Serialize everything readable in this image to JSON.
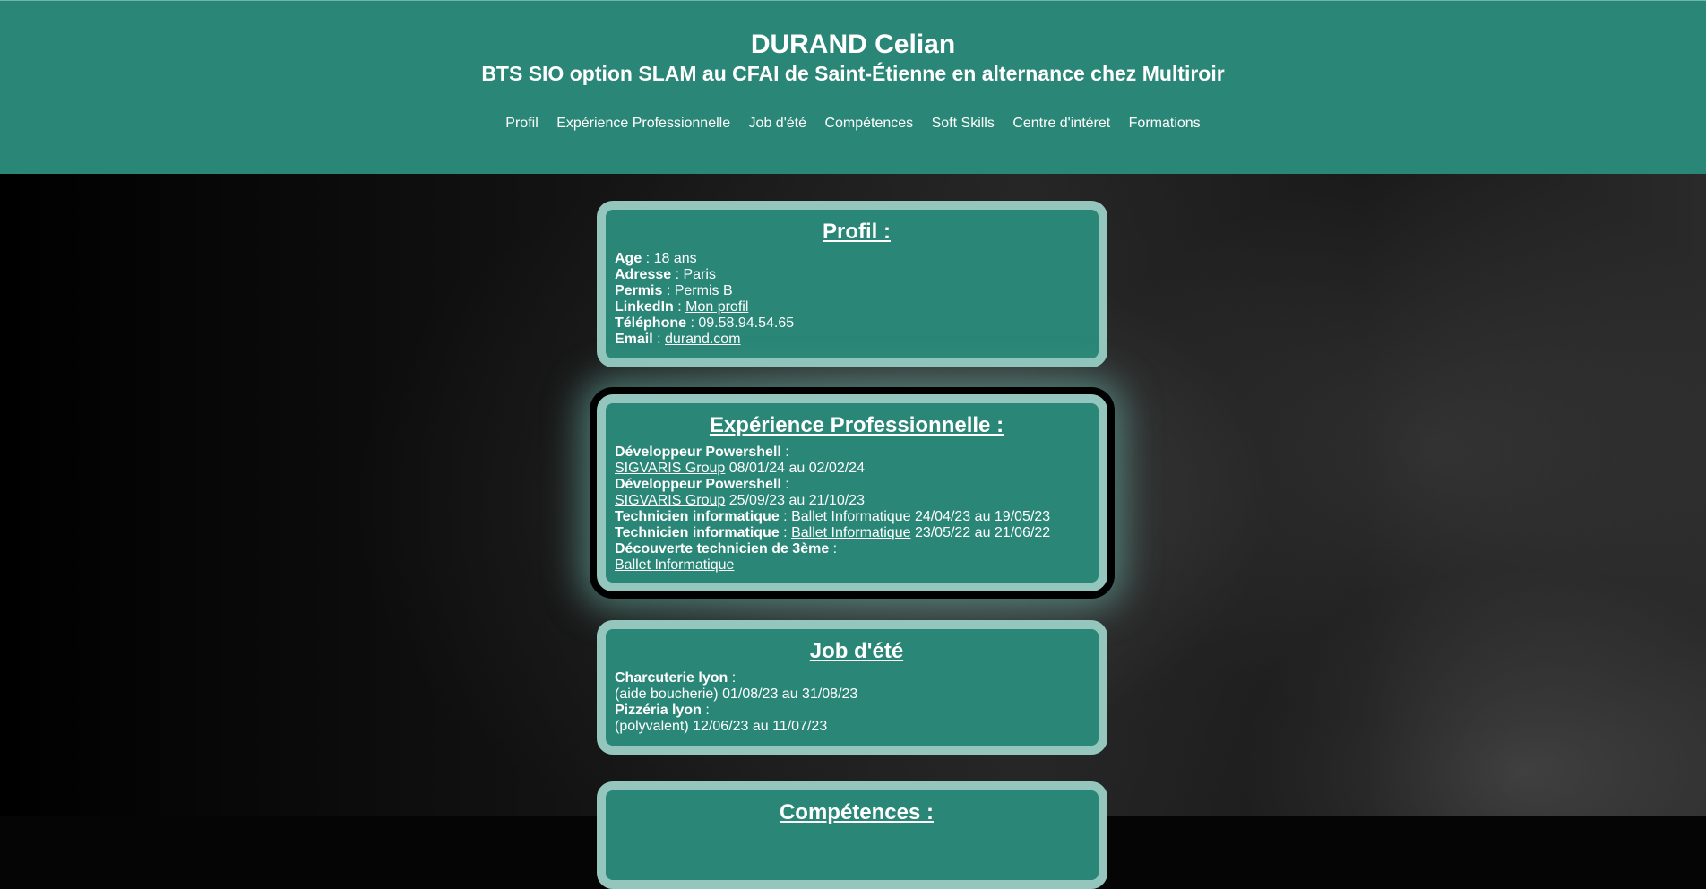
{
  "header": {
    "name": "DURAND Celian",
    "subtitle": "BTS SIO option SLAM au CFAI de Saint-Étienne en alternance chez Multiroir",
    "nav": [
      "Profil",
      "Expérience Professionnelle",
      "Job d'été",
      "Compétences",
      "Soft Skills",
      "Centre d'intéret",
      "Formations"
    ]
  },
  "profil": {
    "title": "Profil :",
    "age_label": "Age",
    "age_value": "18 ans",
    "adresse_label": "Adresse",
    "adresse_value": "Paris",
    "permis_label": "Permis",
    "permis_value": "Permis B",
    "linkedin_label": "LinkedIn",
    "linkedin_link": "Mon profil",
    "telephone_label": "Téléphone",
    "telephone_value": "09.58.94.54.65",
    "email_label": "Email",
    "email_link": "durand.com"
  },
  "experience": {
    "title": "Expérience Professionnelle :",
    "items": [
      {
        "role": "Développeur Powershell",
        "company": "SIGVARIS Group",
        "dates": "08/01/24 au 02/02/24"
      },
      {
        "role": "Développeur Powershell",
        "company": "SIGVARIS Group",
        "dates": "25/09/23 au 21/10/23"
      },
      {
        "role": "Technicien informatique",
        "company": "Ballet Informatique",
        "dates": "24/04/23 au 19/05/23"
      },
      {
        "role": "Technicien informatique",
        "company": "Ballet Informatique",
        "dates": "23/05/22 au 21/06/22"
      },
      {
        "role": "Découverte technicien de 3ème",
        "company": "Ballet Informatique",
        "dates": ""
      }
    ]
  },
  "job": {
    "title": "Job d'été",
    "items": [
      {
        "place": "Charcuterie lyon",
        "detail": "(aide boucherie) 01/08/23 au 31/08/23"
      },
      {
        "place": "Pizzéria lyon",
        "detail": "(polyvalent) 12/06/23 au 11/07/23"
      }
    ]
  },
  "competences": {
    "title": "Compétences :"
  },
  "colors": {
    "primary": "#2a8676",
    "card_border": "#94c6bd",
    "text": "#ffffff"
  }
}
